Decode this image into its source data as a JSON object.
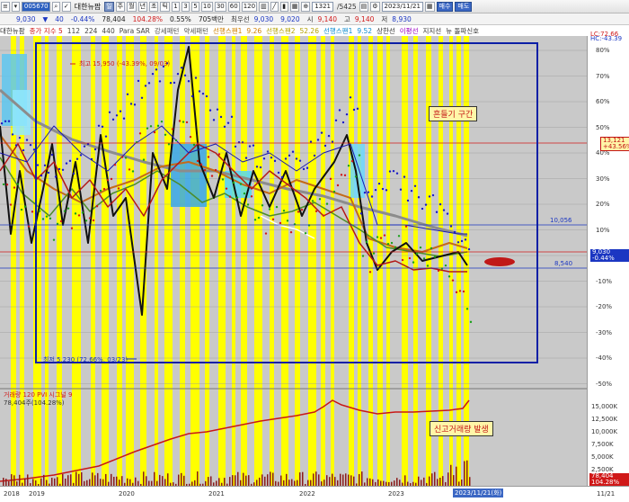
{
  "toolbar": {
    "code": "005670",
    "name": "대한뉴팜",
    "period_buttons": [
      "주",
      "월",
      "년",
      "초",
      "틱"
    ],
    "minute_buttons": [
      "1",
      "3",
      "5",
      "10",
      "30",
      "60",
      "120"
    ],
    "range_value": "1321",
    "range_total": "/5425",
    "date": "2023/11/21",
    "buy_label": "매수",
    "sell_label": "매도"
  },
  "quote": {
    "price": "9,030",
    "change": "40",
    "change_pct": "-0.44%",
    "volume": "78,404",
    "volume_ratio": "104.28%",
    "turnover_rate": "0.55%",
    "amount": "705백만",
    "prev_label": "최우선",
    "prev_value": "9,030",
    "bid": "9,020",
    "open_label": "시",
    "open": "9,140",
    "high_label": "고",
    "high": "9,140",
    "low_label": "저",
    "low": "8,930"
  },
  "legend": {
    "items": [
      "대한뉴팜",
      "종가 지수 5",
      "112",
      "224",
      "440",
      "Para SAR",
      "강세패턴",
      "약세패턴",
      "선행스팬1",
      "9.26",
      "선행스팬2",
      "52.26",
      "선행스팬1",
      "9.52",
      "상한선",
      "이평선",
      "지지선",
      "뉴 돌파신호"
    ],
    "right_top": "LC:72.66",
    "right_bottom": "HC:-43.39"
  },
  "price_axis": {
    "ticks": [
      "80%",
      "70%",
      "60%",
      "50%",
      "40%",
      "30%",
      "20%",
      "10%",
      "0%",
      "-10%",
      "-20%",
      "-30%",
      "-40%",
      "-50%"
    ],
    "flag_top": "13,121",
    "flag_top_pct": "+43.56%",
    "current": "9,030",
    "current_pct": "-0.44%",
    "vol_ticks": [
      "15,000K",
      "12,500K",
      "10,000K",
      "7,500K",
      "5,000K",
      "2,500K"
    ],
    "vol_flag": "78,404",
    "vol_flag_pct": "104.28%"
  },
  "chart": {
    "high_label": "최고 15,950 (-43.39%, 09/03)",
    "low_label": "최저 5,230 (72.66%, 03/23)",
    "level_upper": "10,056",
    "level_lower": "8,540",
    "level_small": "8,240",
    "note_box": "흔들기 구간",
    "volume_legend": "거래량  120  PVI  시그널 9",
    "volume_value": "78,404주(104.28%)",
    "volume_note": "신고거래량 발생"
  },
  "date_axis": {
    "labels": [
      "2018",
      "2019",
      "2020",
      "2021",
      "2022",
      "2023"
    ],
    "current": "2023/11/21(화)",
    "right": "11/21"
  },
  "colors": {
    "highlight": "#ffff00",
    "box": "#0b1fa6",
    "up": "#d01818",
    "down": "#1b36c2"
  }
}
